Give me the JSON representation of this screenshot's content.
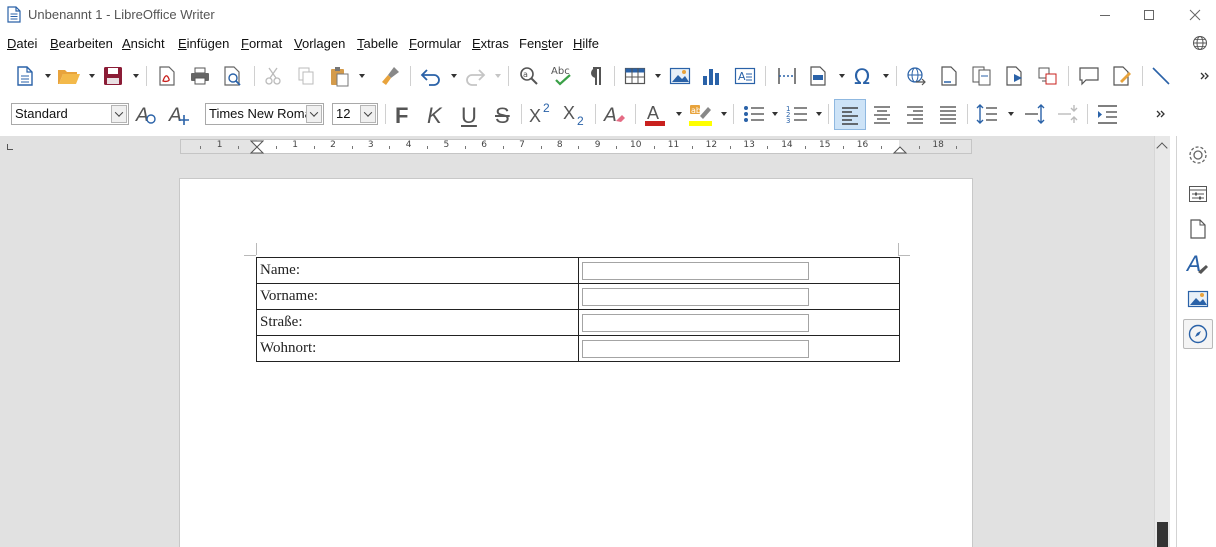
{
  "window": {
    "title": "Unbenannt 1 - LibreOffice Writer",
    "controls": [
      "minimize",
      "maximize",
      "close"
    ]
  },
  "menu": [
    {
      "label": "Datei",
      "accel": "D",
      "rest": "atei"
    },
    {
      "label": "Bearbeiten",
      "accel": "B",
      "rest": "earbeiten"
    },
    {
      "label": "Ansicht",
      "accel": "A",
      "rest": "nsicht"
    },
    {
      "label": "Einfügen",
      "accel": "E",
      "rest": "infügen"
    },
    {
      "label": "Format",
      "accel": "F",
      "rest": "ormat"
    },
    {
      "label": "Vorlagen",
      "accel": "V",
      "rest": "orlagen"
    },
    {
      "label": "Tabelle",
      "accel": "T",
      "rest": "abelle"
    },
    {
      "label": "Formular",
      "accel": "F",
      "rest": "ormular"
    },
    {
      "label": "Extras",
      "accel": "E",
      "rest": "xtras"
    },
    {
      "label": "Fenster",
      "pre": "Fen",
      "accel": "s",
      "rest": "ter"
    },
    {
      "label": "Hilfe",
      "accel": "H",
      "rest": "ilfe"
    }
  ],
  "formatting": {
    "paragraph_style": "Standard",
    "font_name": "Times New Roman",
    "font_size": "12",
    "bold_glyph": "F",
    "italic_glyph": "K",
    "underline_glyph": "U",
    "strike_glyph": "S",
    "font_color": "#c9211e",
    "highlight_color": "#ffff00"
  },
  "ruler": {
    "labels": [
      "1",
      "1",
      "2",
      "3",
      "4",
      "5",
      "6",
      "7",
      "8",
      "9",
      "10",
      "11",
      "12",
      "13",
      "14",
      "15",
      "16",
      "18"
    ]
  },
  "form": {
    "rows": [
      {
        "label": "Name:",
        "value": ""
      },
      {
        "label": "Vorname:",
        "value": ""
      },
      {
        "label": "Straße:",
        "value": ""
      },
      {
        "label": "Wohnort:",
        "value": ""
      }
    ]
  },
  "sidebar": [
    "properties-icon",
    "styles-icon",
    "page-icon",
    "styles-font-icon",
    "gallery-icon",
    "navigator-icon"
  ]
}
